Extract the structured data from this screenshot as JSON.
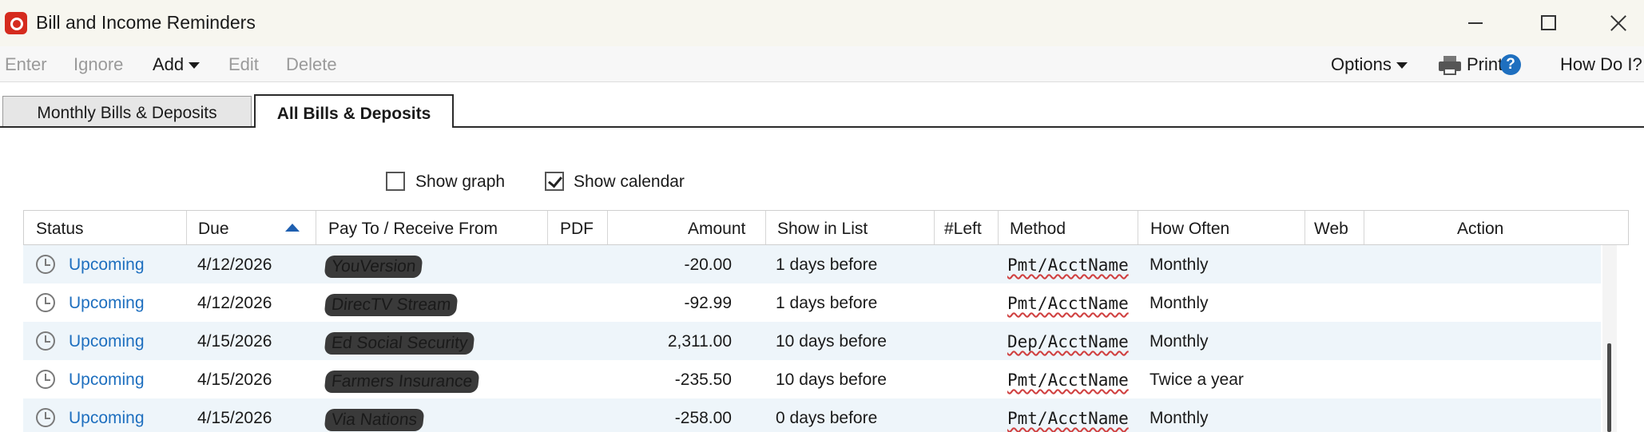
{
  "window": {
    "title": "Bill and Income Reminders"
  },
  "toolbar": {
    "enter": "Enter",
    "ignore": "Ignore",
    "add": "Add",
    "edit": "Edit",
    "delete": "Delete",
    "options": "Options",
    "print": "Print",
    "how_do_i": "How Do I?"
  },
  "tabs": [
    {
      "label": "Monthly Bills & Deposits",
      "active": false
    },
    {
      "label": "All Bills & Deposits",
      "active": true
    }
  ],
  "options": {
    "show_graph": {
      "label": "Show graph",
      "checked": false
    },
    "show_calendar": {
      "label": "Show calendar",
      "checked": true
    }
  },
  "columns": [
    "Status",
    "Due",
    "Pay To / Receive From",
    "PDF",
    "Amount",
    "Show in List",
    "#Left",
    "Method",
    "How Often",
    "Web",
    "Action"
  ],
  "rows": [
    {
      "status": "Upcoming",
      "due": "4/12/2026",
      "payee": "YouVersion",
      "amount": "-20.00",
      "show_in_list": "1 days before",
      "method": "Pmt/AcctName",
      "how_often": "Monthly"
    },
    {
      "status": "Upcoming",
      "due": "4/12/2026",
      "payee": "DirecTV Stream",
      "amount": "-92.99",
      "show_in_list": "1 days before",
      "method": "Pmt/AcctName",
      "how_often": "Monthly"
    },
    {
      "status": "Upcoming",
      "due": "4/15/2026",
      "payee": "Ed Social Security",
      "amount": "2,311.00",
      "show_in_list": "10 days before",
      "method": "Dep/AcctName",
      "how_often": "Monthly"
    },
    {
      "status": "Upcoming",
      "due": "4/15/2026",
      "payee": "Farmers Insurance",
      "amount": "-235.50",
      "show_in_list": "10 days before",
      "method": "Pmt/AcctName",
      "how_often": "Twice a year"
    },
    {
      "status": "Upcoming",
      "due": "4/15/2026",
      "payee": "Via Nations",
      "amount": "-258.00",
      "show_in_list": "0 days before",
      "method": "Pmt/AcctName",
      "how_often": "Monthly"
    }
  ],
  "colors": {
    "link": "#1e6fbf",
    "row_alt": "#eef5fa",
    "brand": "#d52b1e",
    "sort_indicator": "#1e5fb0"
  },
  "sort": {
    "column": "Due",
    "direction": "ascending",
    "icon": "sort-ascending-icon"
  }
}
